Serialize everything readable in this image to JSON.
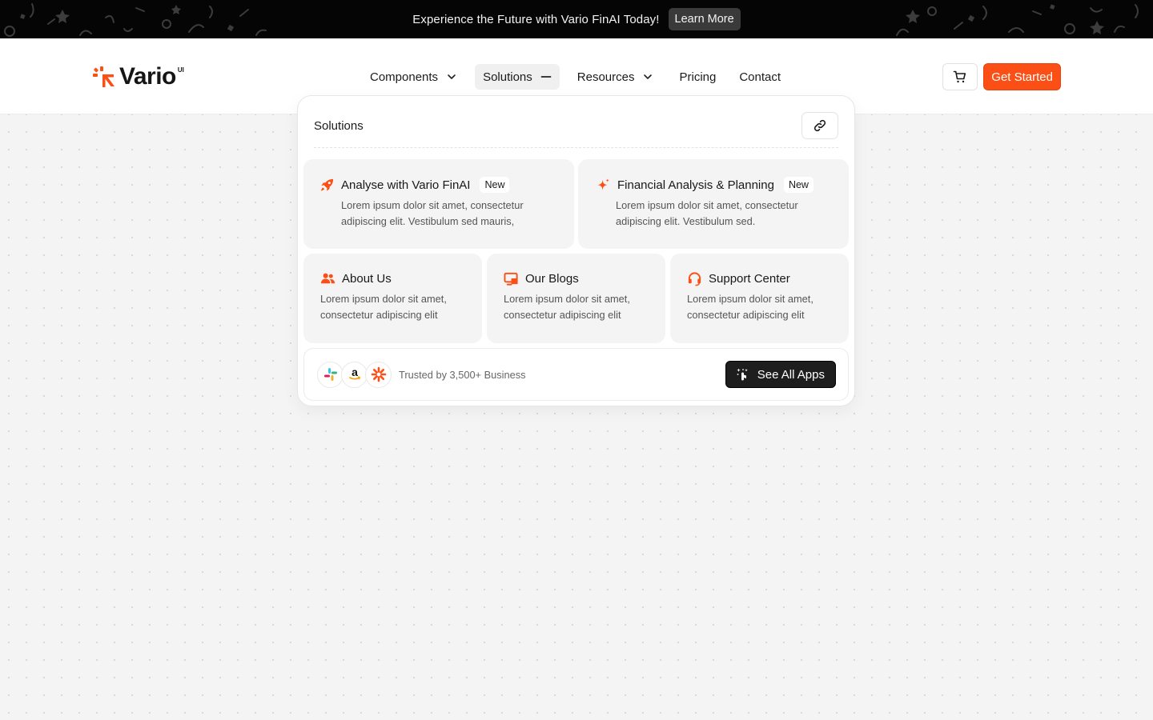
{
  "announcement": {
    "text": "Experience the Future with Vario FinAI Today!",
    "button_label": "Learn More"
  },
  "brand": {
    "name": "Vario",
    "superscript": "UI",
    "accent_color": "#fb4f16"
  },
  "nav": {
    "items": [
      {
        "label": "Components",
        "icon": "chevron-down-icon"
      },
      {
        "label": "Solutions",
        "icon": "minus-icon",
        "active": true
      },
      {
        "label": "Resources",
        "icon": "chevron-down-icon"
      },
      {
        "label": "Pricing"
      },
      {
        "label": "Contact"
      }
    ]
  },
  "header_actions": {
    "cart_icon": "cart-icon",
    "cta_label": "Get Started"
  },
  "dropdown": {
    "title": "Solutions",
    "link_icon": "link-icon",
    "featured": [
      {
        "icon": "rocket-icon",
        "title": "Analyse with Vario FinAI",
        "badge": "New",
        "description_line1": "Lorem ipsum dolor sit amet, consectetur",
        "description_line2": "adipiscing elit. Vestibulum sed mauris,"
      },
      {
        "icon": "sparkle-icon",
        "title": "Financial Analysis & Planning",
        "badge": "New",
        "description_line1": "Lorem ipsum dolor sit amet, consectetur",
        "description_line2": "adipiscing elit. Vestibulum sed."
      }
    ],
    "links": [
      {
        "icon": "users-icon",
        "title": "About Us",
        "description_line1": "Lorem ipsum dolor sit amet,",
        "description_line2": "consectetur adipiscing elit"
      },
      {
        "icon": "monitor-icon",
        "title": "Our Blogs",
        "description_line1": "Lorem ipsum dolor sit amet,",
        "description_line2": "consectetur adipiscing elit"
      },
      {
        "icon": "headset-icon",
        "title": "Support Center",
        "description_line1": "Lorem ipsum dolor sit amet,",
        "description_line2": "consectetur adipiscing elit"
      }
    ],
    "footer": {
      "partner_icons": [
        "slack-icon",
        "amazon-icon",
        "zapier-icon"
      ],
      "trusted_text": "Trusted by 3,500+ Business",
      "button_label": "See All Apps",
      "button_icon": "sparkle-hand-icon"
    }
  }
}
